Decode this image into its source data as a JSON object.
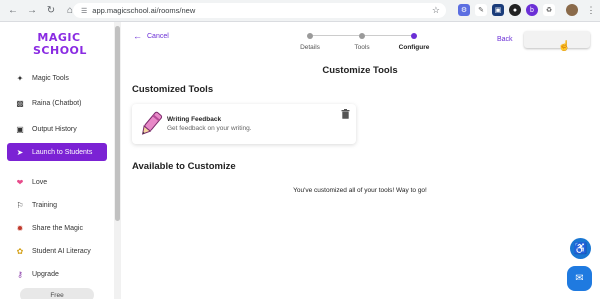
{
  "browser": {
    "url": "app.magicschool.ai/rooms/new"
  },
  "logo": {
    "line1": "MAGIC",
    "line2": "SCHOOL"
  },
  "sidebar": {
    "items": [
      {
        "label": "Magic Tools",
        "icon": "wand-icon"
      },
      {
        "label": "Raina (Chatbot)",
        "icon": "robot-icon"
      },
      {
        "label": "Output History",
        "icon": "history-icon"
      },
      {
        "label": "Launch to Students",
        "icon": "rocket-icon",
        "active": true
      },
      {
        "label": "Love",
        "icon": "heart-icon"
      },
      {
        "label": "Training",
        "icon": "training-icon"
      },
      {
        "label": "Share the Magic",
        "icon": "share-icon"
      },
      {
        "label": "Student AI Literacy",
        "icon": "bunny-icon"
      },
      {
        "label": "Upgrade",
        "icon": "potion-icon"
      }
    ],
    "plan_label": "Free"
  },
  "header": {
    "cancel_label": "Cancel",
    "back_label": "Back",
    "steps": [
      {
        "label": "Details",
        "state": "done"
      },
      {
        "label": "Tools",
        "state": "done"
      },
      {
        "label": "Configure",
        "state": "current"
      }
    ]
  },
  "main": {
    "page_title": "Customize Tools",
    "customized_heading": "Customized Tools",
    "tools": [
      {
        "name": "Writing Feedback",
        "description": "Get feedback on your writing."
      }
    ],
    "available_heading": "Available to Customize",
    "empty_message": "You've customized all of your tools! Way to go!"
  },
  "colors": {
    "accent": "#7b22d4",
    "link": "#6b2fd6",
    "help_blue": "#1f7ae0"
  }
}
